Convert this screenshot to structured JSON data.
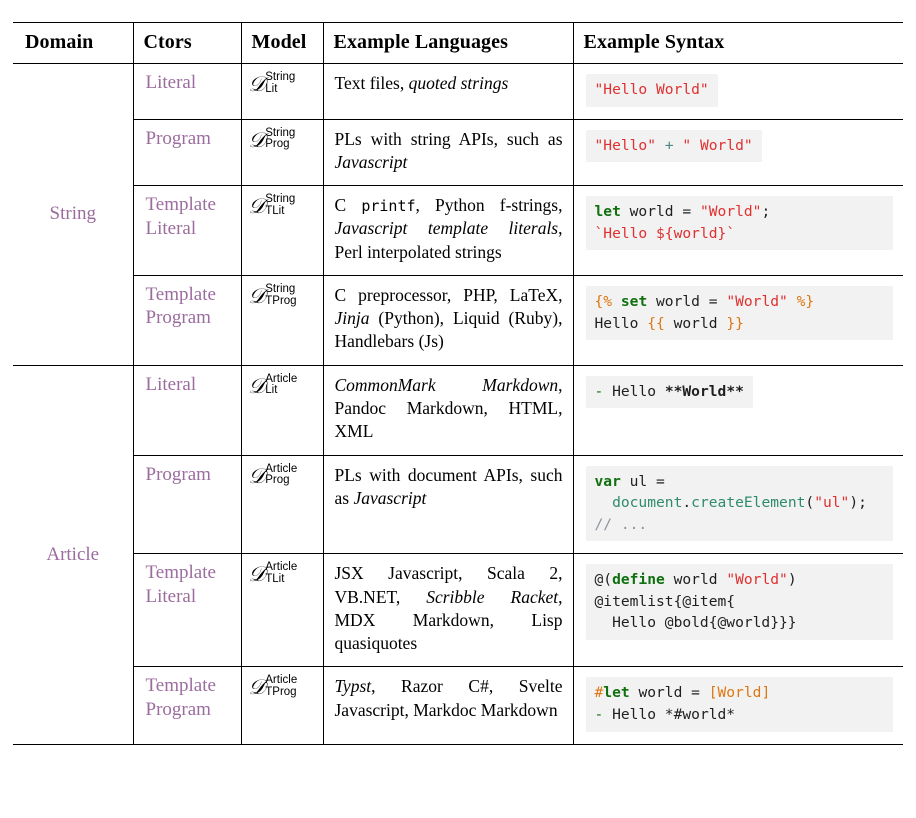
{
  "table": {
    "headers": [
      {
        "key": "domain",
        "label": "Domain"
      },
      {
        "key": "ctors",
        "label": "Ctors"
      },
      {
        "key": "model",
        "label": "Model"
      },
      {
        "key": "langs",
        "label": "Example Languages"
      },
      {
        "key": "syntax",
        "label": "Example Syntax"
      }
    ],
    "accent_color": "#9b6c9e",
    "code_bg": "#f2f2f2",
    "groups": [
      {
        "domain": "String",
        "rows": [
          {
            "ctors": "Literal",
            "model": {
              "base": "D",
              "sup": "String",
              "sub": "Lit"
            },
            "langs_plain": "Text files, quoted strings",
            "syntax_plain": "\"Hello World\""
          },
          {
            "ctors": "Program",
            "model": {
              "base": "D",
              "sup": "String",
              "sub": "Prog"
            },
            "langs_plain": "PLs with string APIs, such as Javascript",
            "syntax_plain": "\"Hello\" + \" World\""
          },
          {
            "ctors": "Template Literal",
            "model": {
              "base": "D",
              "sup": "String",
              "sub": "TLit"
            },
            "langs_plain": "C printf, Python f-strings, Javascript template literals, Perl interpolated strings",
            "syntax_plain": "let world = \"World\";\n`Hello ${world}`"
          },
          {
            "ctors": "Template Program",
            "model": {
              "base": "D",
              "sup": "String",
              "sub": "TProg"
            },
            "langs_plain": "C preprocessor, PHP, LaTeX, Jinja (Python), Liquid (Ruby), Handlebars (Js)",
            "syntax_plain": "{% set world = \"World\" %}\nHello {{ world }}"
          }
        ]
      },
      {
        "domain": "Article",
        "rows": [
          {
            "ctors": "Literal",
            "model": {
              "base": "D",
              "sup": "Article",
              "sub": "Lit"
            },
            "langs_plain": "CommonMark Markdown, Pandoc Markdown, HTML, XML",
            "syntax_plain": "- Hello **World**"
          },
          {
            "ctors": "Program",
            "model": {
              "base": "D",
              "sup": "Article",
              "sub": "Prog"
            },
            "langs_plain": "PLs with document APIs, such as Javascript",
            "syntax_plain": "var ul =\n  document.createElement(\"ul\");\n// ..."
          },
          {
            "ctors": "Template Literal",
            "model": {
              "base": "D",
              "sup": "Article",
              "sub": "TLit"
            },
            "langs_plain": "JSX Javascript, Scala 2, VB.NET, Scribble Racket, MDX Markdown, Lisp quasiquotes",
            "syntax_plain": "@(define world \"World\")\n@itemlist{@item{\n  Hello @bold{@world}}}"
          },
          {
            "ctors": "Template Program",
            "model": {
              "base": "D",
              "sup": "Article",
              "sub": "TProg"
            },
            "langs_plain": "Typst, Razor C#, Svelte Javascript, Markdoc Markdown",
            "syntax_plain": "#let world = [World]\n- Hello *#world*"
          }
        ]
      }
    ]
  }
}
